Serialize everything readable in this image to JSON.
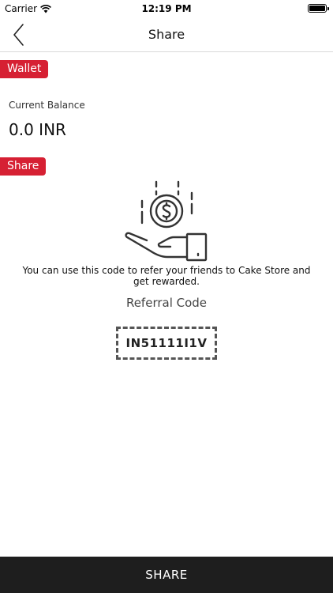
{
  "status_bar": {
    "carrier": "Carrier",
    "time": "12:19 PM",
    "icons": [
      "wifi-icon",
      "battery-icon"
    ]
  },
  "nav": {
    "title": "Share",
    "back_icon": "chevron-left-icon"
  },
  "wallet": {
    "tag": "Wallet",
    "balance_label": "Current Balance",
    "balance_value": "0.0 INR"
  },
  "share": {
    "tag": "Share",
    "illustration_icon": "hand-coin-icon",
    "info_text": "You can use this code to refer your friends to Cake Store and get rewarded.",
    "referral_title": "Referral Code",
    "referral_code": "IN51111I1V"
  },
  "footer": {
    "share_button_label": "SHARE"
  },
  "colors": {
    "accent": "#d62033",
    "footer_bg": "#1e1e1e",
    "divider": "#d9d9d9"
  }
}
